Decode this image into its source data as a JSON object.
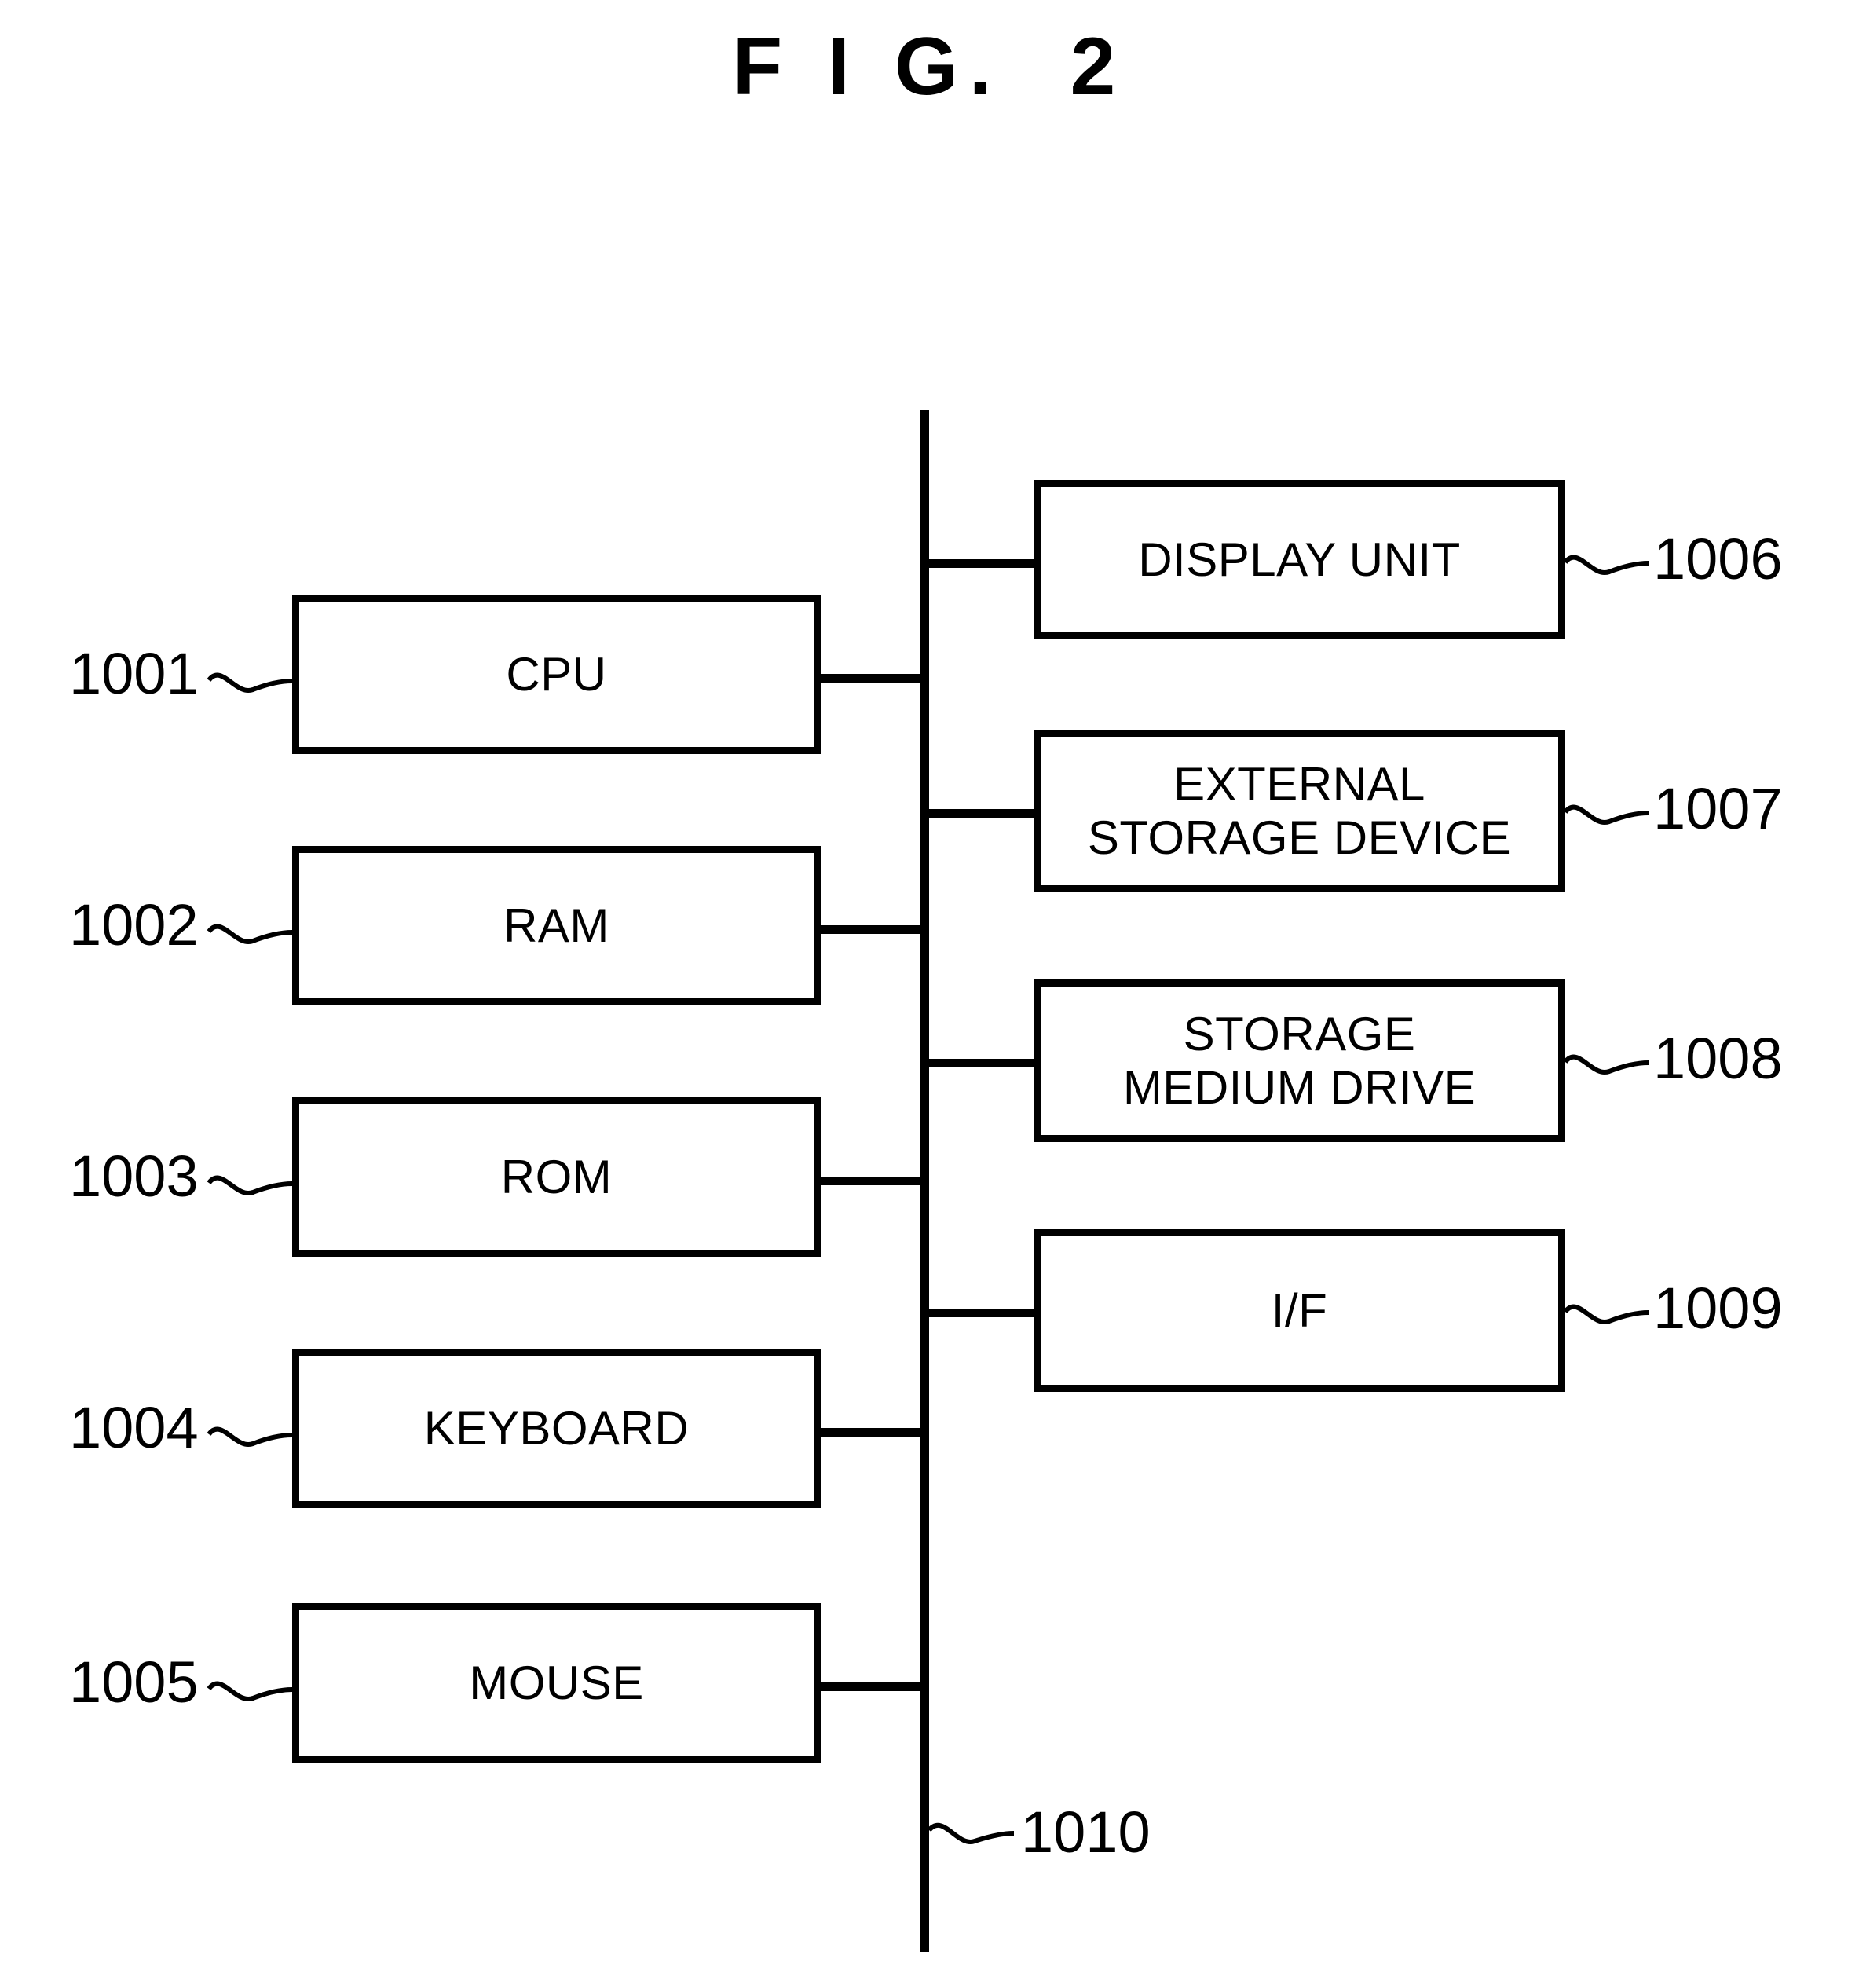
{
  "figure": {
    "title": "F I G.  2",
    "ink_color": "#000000",
    "background_color": "#ffffff"
  },
  "bus": {
    "ref": "1010",
    "name": "system-bus"
  },
  "left_column": [
    {
      "ref": "1001",
      "label": "CPU"
    },
    {
      "ref": "1002",
      "label": "RAM"
    },
    {
      "ref": "1003",
      "label": "ROM"
    },
    {
      "ref": "1004",
      "label": "KEYBOARD"
    },
    {
      "ref": "1005",
      "label": "MOUSE"
    }
  ],
  "right_column": [
    {
      "ref": "1006",
      "label": "DISPLAY UNIT"
    },
    {
      "ref": "1007",
      "label": "EXTERNAL\nSTORAGE DEVICE"
    },
    {
      "ref": "1008",
      "label": "STORAGE\nMEDIUM DRIVE"
    },
    {
      "ref": "1009",
      "label": "I/F"
    }
  ]
}
